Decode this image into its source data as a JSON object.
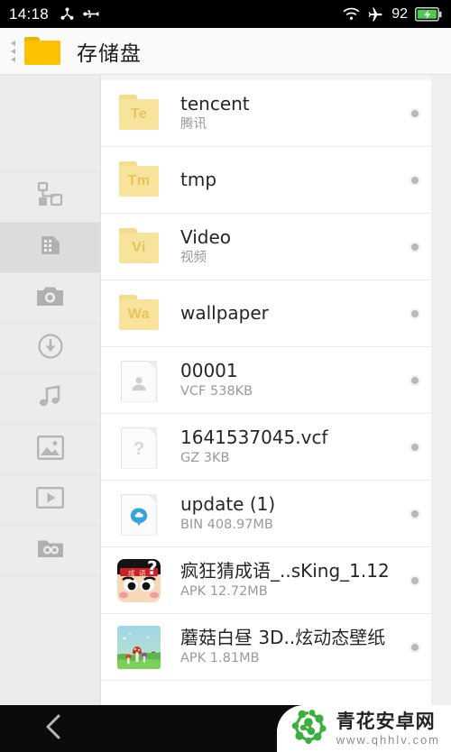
{
  "statusbar": {
    "time": "14:18",
    "battery_level": "92",
    "icons": [
      "bluetooth-share-icon",
      "usb-icon",
      "wifi-icon",
      "airplane-mode-icon",
      "battery-charging-icon"
    ]
  },
  "header": {
    "title": "存储盘",
    "folder_icon": "folder-icon",
    "drawer_handle": "drawer-collapse-handle"
  },
  "sidebar": {
    "items": [
      {
        "name": "category-icon",
        "label": "分类",
        "active": false
      },
      {
        "name": "sdcard-icon",
        "label": "存储盘",
        "active": true
      },
      {
        "name": "camera-icon",
        "label": "相机",
        "active": false
      },
      {
        "name": "download-icon",
        "label": "下载",
        "active": false
      },
      {
        "name": "music-icon",
        "label": "音乐",
        "active": false
      },
      {
        "name": "image-icon",
        "label": "图片",
        "active": false
      },
      {
        "name": "video-icon",
        "label": "视频",
        "active": false
      },
      {
        "name": "archive-folder-icon",
        "label": "文件夹",
        "active": false
      }
    ]
  },
  "file_list": [
    {
      "icon": "folder-icon",
      "badge": "Te",
      "name": "tencent",
      "sub": "腾讯",
      "selected": false
    },
    {
      "icon": "folder-icon",
      "badge": "Tm",
      "name": "tmp",
      "sub": "",
      "selected": false
    },
    {
      "icon": "folder-icon",
      "badge": "Vi",
      "name": "Video",
      "sub": "视频",
      "selected": false
    },
    {
      "icon": "folder-icon",
      "badge": "Wa",
      "name": "wallpaper",
      "sub": "",
      "selected": false
    },
    {
      "icon": "contact-file-icon",
      "badge": "",
      "name": "00001",
      "sub": "VCF 538KB",
      "selected": false
    },
    {
      "icon": "unknown-file-icon",
      "badge": "",
      "name": "1641537045.vcf",
      "sub": "GZ 3KB",
      "selected": false
    },
    {
      "icon": "cloud-file-icon",
      "badge": "",
      "name": "update (1)",
      "sub": "BIN 408.97MB",
      "selected": false
    },
    {
      "icon": "apk-game-icon",
      "badge": "",
      "name": "疯狂猜成语_..sKing_1.12",
      "sub": "APK 12.72MB",
      "selected": false
    },
    {
      "icon": "apk-wallpaper-icon",
      "badge": "",
      "name": "蘑菇白昼 3D..炫动态壁纸",
      "sub": "APK 1.81MB",
      "selected": false
    }
  ],
  "navbar": {
    "back_icon": "back-chevron-icon"
  },
  "watermark": {
    "logo": "molecule-logo-icon",
    "site_name": "青花安卓网",
    "url": "www.qhhlv.com",
    "logo_color": "#3caf3c"
  },
  "colors": {
    "accent_folder": "#fcc200",
    "list_folder": "#f7e39b",
    "background": "#efefef",
    "panel": "#ffffff",
    "sidebar": "#ececec",
    "sidebar_active": "#dcdcdc",
    "title_text": "#262626",
    "sub_text": "#9a9a9a",
    "battery_green": "#4ccd4c"
  }
}
